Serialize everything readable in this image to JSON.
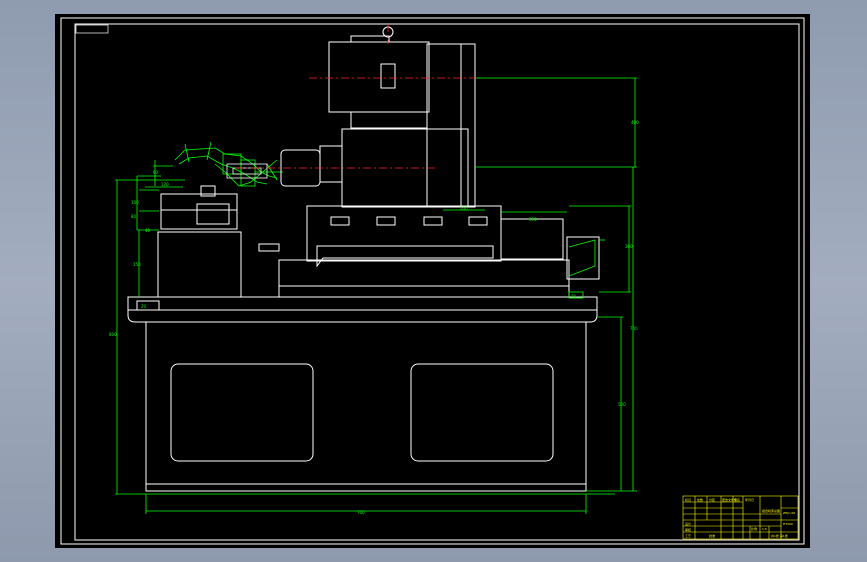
{
  "drawing": {
    "background": "#000000",
    "colors": {
      "outline": "#ffffff",
      "dimension": "#00ff00",
      "centerline": "#ff2020",
      "title_block": "#ffff00",
      "screen_bg": "#9aa5b8"
    },
    "dimensions": {
      "overall_width": "700",
      "base_height": "700",
      "table_travel": "200",
      "column_height": "400",
      "cabinet_height": "500",
      "slide_length": "350",
      "head_height": "600",
      "left_height": "800",
      "fixture_a": "100",
      "fixture_b": "150",
      "fixture_c": "120",
      "fixture_d": "60",
      "fixture_e": "80",
      "fixture_f": "40",
      "small_a": "20",
      "right_a": "300",
      "right_b": "70"
    },
    "title_block": {
      "header_cells": [
        "标记",
        "处数",
        "分区",
        "更改文件号",
        "签名",
        "年月日"
      ],
      "rows": [
        "设计",
        "审核",
        "工艺",
        "批准"
      ],
      "name": "组合机床总图",
      "drawing_no": "ZHJC-00",
      "scale_label": "比例",
      "scale": "1:5",
      "sheet": "共1张 第1张",
      "material": "HT200"
    }
  }
}
